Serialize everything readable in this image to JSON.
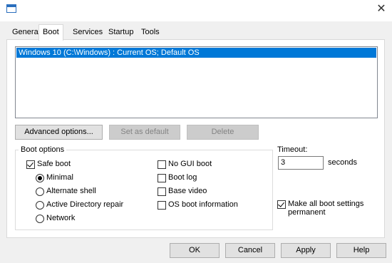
{
  "tabs": [
    {
      "label": "General"
    },
    {
      "label": "Boot"
    },
    {
      "label": "Services"
    },
    {
      "label": "Startup"
    },
    {
      "label": "Tools"
    }
  ],
  "os_list": {
    "entries": [
      "Windows 10 (C:\\Windows) : Current OS; Default OS"
    ]
  },
  "actions": {
    "advanced_options": "Advanced options...",
    "set_as_default": "Set as default",
    "delete": "Delete"
  },
  "boot_options": {
    "title": "Boot options",
    "safe_boot": "Safe boot",
    "minimal": "Minimal",
    "alternate_shell": "Alternate shell",
    "active_directory_repair": "Active Directory repair",
    "network": "Network",
    "no_gui_boot": "No GUI boot",
    "boot_log": "Boot log",
    "base_video": "Base video",
    "os_boot_information": "OS boot information"
  },
  "timeout": {
    "label": "Timeout:",
    "value": "3",
    "unit": "seconds"
  },
  "make_permanent": {
    "line1": "Make all boot settings",
    "line2": "permanent"
  },
  "footer": {
    "ok": "OK",
    "cancel": "Cancel",
    "apply": "Apply",
    "help": "Help"
  },
  "state": {
    "active_tab": "Boot",
    "safe_boot_checked": true,
    "selected_safe_mode": "Minimal",
    "make_permanent_checked": true
  }
}
